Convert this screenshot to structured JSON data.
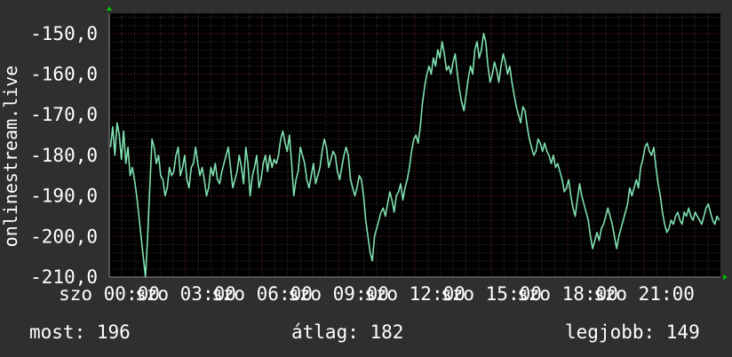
{
  "chart_data": {
    "type": "line",
    "ylabel": "onlinestream.live",
    "y_ticks": [
      "-150,0",
      "-160,0",
      "-170,0",
      "-180,0",
      "-190,0",
      "-200,0",
      "-210,0"
    ],
    "x_ticks": [
      "szo 00:00",
      "szo 03:00",
      "szo 06:00",
      "szo 09:00",
      "szo 12:00",
      "szo 15:00",
      "szo 18:00",
      "szo 21:00"
    ],
    "x_range_hours": [
      0,
      24
    ],
    "ylim": [
      -210,
      -145
    ],
    "grid": true,
    "series": [
      {
        "color": "#7fe0b0",
        "values": [
          -178,
          -173,
          -180,
          -172,
          -175,
          -181,
          -174,
          -182,
          -178,
          -185,
          -183,
          -186,
          -190,
          -195,
          -200,
          -205,
          -210,
          -200,
          -188,
          -176,
          -178,
          -182,
          -180,
          -185,
          -186,
          -190,
          -188,
          -183,
          -185,
          -184,
          -180,
          -178,
          -185,
          -183,
          -180,
          -186,
          -188,
          -183,
          -182,
          -178,
          -182,
          -185,
          -183,
          -186,
          -190,
          -188,
          -183,
          -185,
          -182,
          -186,
          -187,
          -184,
          -182,
          -180,
          -178,
          -183,
          -188,
          -186,
          -184,
          -180,
          -183,
          -187,
          -178,
          -182,
          -190,
          -185,
          -183,
          -180,
          -188,
          -186,
          -182,
          -180,
          -184,
          -180,
          -183,
          -181,
          -182,
          -180,
          -176,
          -174,
          -177,
          -179,
          -175,
          -182,
          -190,
          -186,
          -184,
          -178,
          -180,
          -182,
          -186,
          -188,
          -185,
          -182,
          -187,
          -185,
          -183,
          -179,
          -176,
          -178,
          -183,
          -181,
          -179,
          -180,
          -184,
          -186,
          -183,
          -180,
          -178,
          -180,
          -186,
          -188,
          -190,
          -188,
          -185,
          -186,
          -190,
          -196,
          -200,
          -204,
          -206,
          -200,
          -198,
          -196,
          -194,
          -193,
          -195,
          -192,
          -189,
          -191,
          -194,
          -190,
          -189,
          -187,
          -191,
          -188,
          -186,
          -183,
          -179,
          -176,
          -175,
          -177,
          -173,
          -167,
          -163,
          -160,
          -158,
          -160,
          -156,
          -158,
          -154,
          -156,
          -152,
          -155,
          -159,
          -158,
          -160,
          -157,
          -155,
          -160,
          -164,
          -167,
          -169,
          -165,
          -161,
          -158,
          -160,
          -154,
          -152,
          -156,
          -154,
          -150,
          -152,
          -158,
          -162,
          -160,
          -157,
          -159,
          -162,
          -158,
          -155,
          -157,
          -160,
          -158,
          -162,
          -165,
          -168,
          -170,
          -172,
          -168,
          -169,
          -173,
          -176,
          -178,
          -180,
          -179,
          -176,
          -177,
          -179,
          -177,
          -179,
          -180,
          -182,
          -180,
          -183,
          -182,
          -184,
          -186,
          -189,
          -188,
          -186,
          -190,
          -193,
          -195,
          -191,
          -187,
          -190,
          -192,
          -194,
          -196,
          -200,
          -203,
          -201,
          -199,
          -201,
          -198,
          -197,
          -195,
          -193,
          -195,
          -197,
          -200,
          -203,
          -200,
          -198,
          -196,
          -194,
          -192,
          -188,
          -190,
          -188,
          -186,
          -188,
          -183,
          -181,
          -178,
          -177,
          -179,
          -180,
          -178,
          -183,
          -187,
          -190,
          -194,
          -197,
          -199,
          -198,
          -196,
          -197,
          -195,
          -194,
          -196,
          -197,
          -194,
          -195,
          -193,
          -195,
          -196,
          -194,
          -195,
          -196,
          -197,
          -195,
          -193,
          -192,
          -194,
          -196,
          -197,
          -195,
          -196
        ]
      }
    ]
  },
  "stats": {
    "now": "most: 196",
    "avg": "átlag: 182",
    "best": "legjobb: 149"
  }
}
